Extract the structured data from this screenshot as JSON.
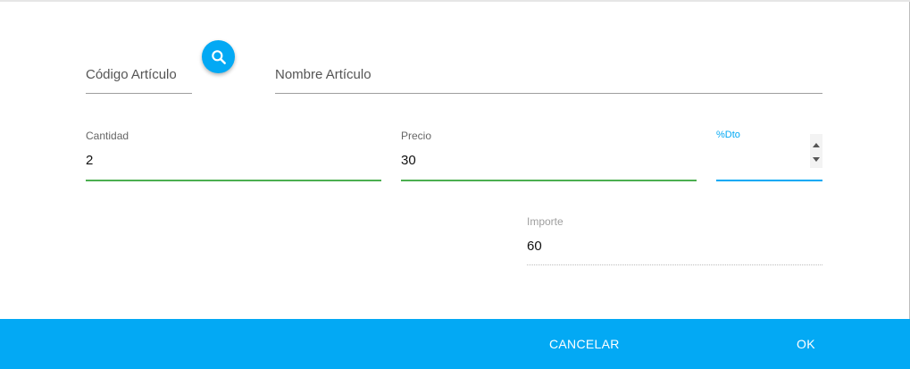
{
  "form": {
    "codigo_articulo": {
      "placeholder": "Código Artículo",
      "value": ""
    },
    "nombre_articulo": {
      "placeholder": "Nombre Artículo",
      "value": ""
    },
    "cantidad": {
      "label": "Cantidad",
      "value": "2"
    },
    "precio": {
      "label": "Precio",
      "value": "30"
    },
    "dto": {
      "label": "%Dto",
      "value": ""
    },
    "importe": {
      "label": "Importe",
      "value": "60"
    }
  },
  "footer": {
    "cancel_label": "CANCELAR",
    "ok_label": "OK"
  },
  "icons": {
    "search": "search-icon",
    "spinner_up": "arrow-up-icon",
    "spinner_down": "arrow-down-icon"
  },
  "colors": {
    "accent": "#03a9f4",
    "valid_underline": "#4caf50",
    "focus_underline": "#03a9f4",
    "label_focused": "#03a9f4"
  }
}
